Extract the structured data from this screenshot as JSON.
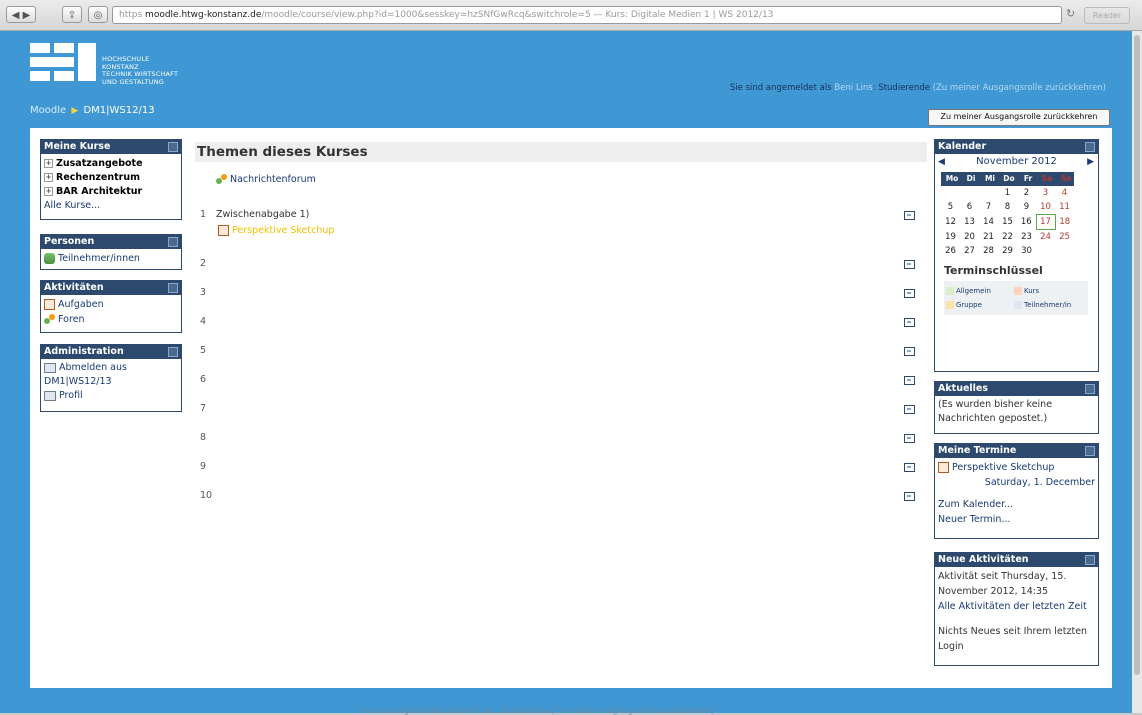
{
  "browser": {
    "url_host": "moodle.htwg-konstanz.de",
    "url_prefix": "https",
    "url_path": "/moodle/course/view.php?id=1000&sesskey=hzSNfGwRcq&switchrole=5 — Kurs: Digitale Medien 1 | WS 2012/13",
    "reader_label": "Reader"
  },
  "header": {
    "logo_text": [
      "HOCHSCHULE",
      "KONSTANZ",
      "TECHNIK WIRTSCHAFT",
      "UND GESTALTUNG"
    ],
    "logged_in_prefix": "Sie sind angemeldet als",
    "user_name": "Beni Lins",
    "role_text": ": Studierende",
    "return_link": "(Zu meiner Ausgangsrolle zurückkehren)",
    "breadcrumb_home": "Moodle",
    "breadcrumb_sep": "▶",
    "breadcrumb_course": "DM1|WS12/13",
    "role_button": "Zu meiner Ausgangsrolle zurückkehren"
  },
  "left": {
    "my_courses": {
      "title": "Meine Kurse",
      "items": [
        "Zusatzangebote",
        "Rechenzentrum",
        "BAR Architektur"
      ],
      "all_link": "Alle Kurse..."
    },
    "people": {
      "title": "Personen",
      "item": "Teilnehmer/innen"
    },
    "activities": {
      "title": "Aktivitäten",
      "items": [
        "Aufgaben",
        "Foren"
      ]
    },
    "administration": {
      "title": "Administration",
      "item1_a": "Abmelden aus",
      "item1_b": "DM1|WS12/13",
      "item2": "Profil"
    }
  },
  "main": {
    "title": "Themen dieses Kurses",
    "news_forum": "Nachrichtenforum",
    "sections": [
      "1",
      "2",
      "3",
      "4",
      "5",
      "6",
      "7",
      "8",
      "9",
      "10"
    ],
    "section1_title": "Zwischenabgabe 1)",
    "section1_link": "Perspektive Sketchup"
  },
  "right": {
    "calendar": {
      "title": "Kalender",
      "month": "November 2012",
      "prev": "◀",
      "next": "▶",
      "weekdays": [
        "Mo",
        "Di",
        "Mi",
        "Do",
        "Fr",
        "Sa",
        "So"
      ],
      "weeks": [
        [
          "",
          "",
          "",
          "1",
          "2",
          "3",
          "4"
        ],
        [
          "5",
          "6",
          "7",
          "8",
          "9",
          "10",
          "11"
        ],
        [
          "12",
          "13",
          "14",
          "15",
          "16",
          "17",
          "18"
        ],
        [
          "19",
          "20",
          "21",
          "22",
          "23",
          "24",
          "25"
        ],
        [
          "26",
          "27",
          "28",
          "29",
          "30",
          "",
          ""
        ]
      ],
      "today": "17",
      "key_title": "Terminschlüssel",
      "keys": [
        "Allgemein",
        "Kurs",
        "Gruppe",
        "Teilnehmer/in"
      ]
    },
    "news": {
      "title": "Aktuelles",
      "text": "(Es wurden bisher keine Nachrichten gepostet.)"
    },
    "upcoming": {
      "title": "Meine Termine",
      "event": "Perspektive Sketchup",
      "date": "Saturday, 1. December",
      "link1": "Zum Kalender...",
      "link2": "Neuer Termin..."
    },
    "recent": {
      "title": "Neue Aktivitäten",
      "since": "Aktivität seit Thursday, 15. November 2012, 14:35",
      "all_link": "Alle Aktivitäten der letzten Zeit",
      "nothing": "Nichts Neues seit Ihrem letzten Login"
    }
  },
  "footer": {
    "text": "Sie sind angemeldet als Beni Lins: Studierende (Zu meiner Ausgangsrolle zurückkehren)"
  },
  "colors": {
    "page_bg": "#3f98d4",
    "block_header": "#2d4a6e",
    "link": "#1a3a75",
    "activity_link": "#f0c000"
  }
}
